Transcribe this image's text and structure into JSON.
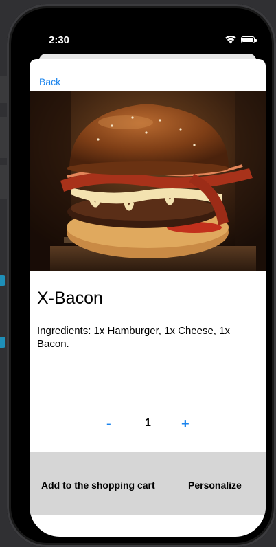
{
  "status_bar": {
    "time": "2:30"
  },
  "nav": {
    "back_label": "Back"
  },
  "product": {
    "name": "X-Bacon",
    "ingredients": "Ingredients: 1x Hamburger, 1x Cheese, 1x Bacon."
  },
  "quantity": {
    "minus_label": "-",
    "value": "1",
    "plus_label": "+"
  },
  "actions": {
    "add_to_cart_label": "Add to the shopping cart",
    "personalize_label": "Personalize"
  },
  "colors": {
    "accent": "#1a84ee",
    "action_bar": "#d6d6d6"
  }
}
